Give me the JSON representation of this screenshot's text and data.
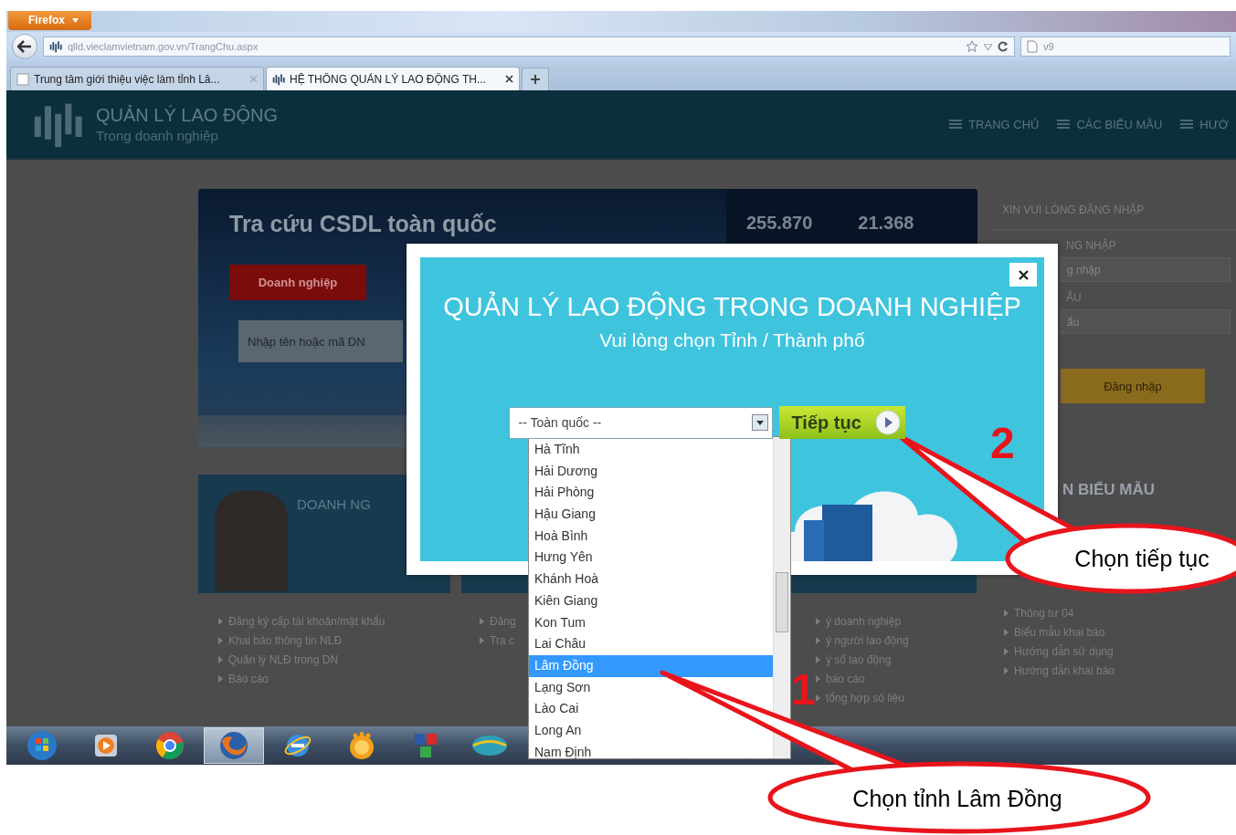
{
  "browser": {
    "menu_button": "Firefox",
    "url": "qlld.vieclamvietnam.gov.vn/TrangChu.aspx",
    "search_text": "ν9",
    "tabs": [
      {
        "title": "Trung tâm giới thiệu việc làm tỉnh Lâ...",
        "selected": false
      },
      {
        "title": "HỆ THỐNG QUẢN LÝ LAO ĐỘNG TH...",
        "selected": true
      }
    ]
  },
  "site_header": {
    "title": "QUẢN LÝ LAO ĐỘNG",
    "subtitle": "Trong doanh nghiệp",
    "nav": [
      "TRANG CHỦ",
      "CÁC BIỂU MẪU",
      "HƯỚ"
    ]
  },
  "search_panel": {
    "title": "Tra cứu CSDL toàn quốc",
    "stats": [
      "255.870",
      "21.368"
    ],
    "tabs": [
      {
        "label": "Doanh nghiệp",
        "selected": true
      }
    ],
    "placeholder": "Nhập tên hoặc mã DN"
  },
  "login_panel": {
    "heading": "XIN VUI LÒNG ĐĂNG NHẬP",
    "username_label": "NG NHẬP",
    "username_placeholder": "g nhập",
    "password_label": "ẨU",
    "password_placeholder": "ẩu",
    "button": "Đăng nhập"
  },
  "cards": [
    {
      "heading": "DOANH NG",
      "links": [
        "Đăng ký cấp tài khoản/mật khẩu",
        "Khai báo thông tin NLĐ",
        "Quản lý NLĐ trong DN",
        "Báo cáo"
      ]
    },
    {
      "links": [
        "Đăng",
        "Tra c"
      ]
    },
    {
      "links": [
        "ý doanh nghiệp",
        "ý người lao động",
        "ý sổ lao động",
        "báo cáo",
        "tổng hợp số liệu"
      ]
    },
    {
      "heading": "N BIỂU MẪU",
      "links": [
        "Thông tư 04",
        "Biểu mẫu khai báo",
        "Hướng dẫn sử dụng",
        "Hướng dẫn khai báo"
      ]
    }
  ],
  "modal": {
    "title": "QUẢN LÝ LAO ĐỘNG TRONG DOANH NGHIỆP",
    "subtitle": "Vui lòng chọn Tỉnh / Thành phố",
    "select": {
      "value": "-- Toàn quốc --",
      "expanded": true
    },
    "button": "Tiếp tục",
    "options": [
      {
        "label": "Hà Tĩnh",
        "selected": false
      },
      {
        "label": "Hải Dương",
        "selected": false
      },
      {
        "label": "Hải Phòng",
        "selected": false
      },
      {
        "label": "Hậu Giang",
        "selected": false
      },
      {
        "label": "Hoà Bình",
        "selected": false
      },
      {
        "label": "Hưng Yên",
        "selected": false
      },
      {
        "label": "Khánh Hoà",
        "selected": false
      },
      {
        "label": "Kiên Giang",
        "selected": false
      },
      {
        "label": "Kon Tum",
        "selected": false
      },
      {
        "label": "Lai Châu",
        "selected": false
      },
      {
        "label": "Lâm Đồng",
        "selected": true
      },
      {
        "label": "Lạng Sơn",
        "selected": false
      },
      {
        "label": "Lào Cai",
        "selected": false
      },
      {
        "label": "Long An",
        "selected": false
      },
      {
        "label": "Nam Định",
        "selected": false
      }
    ]
  },
  "taskbar": [
    {
      "kind": "orb",
      "active": false
    },
    {
      "kind": "player",
      "active": false
    },
    {
      "kind": "ring",
      "active": false
    },
    {
      "kind": "fox",
      "active": true
    },
    {
      "kind": "globe",
      "active": false
    },
    {
      "kind": "ball",
      "active": false
    },
    {
      "kind": "tiles",
      "active": false
    },
    {
      "kind": "wave",
      "active": false
    }
  ],
  "annotations": [
    {
      "number": "1",
      "callout": "Chọn tỉnh Lâm Đồng"
    },
    {
      "number": "2",
      "callout": "Chọn tiếp tục"
    }
  ]
}
